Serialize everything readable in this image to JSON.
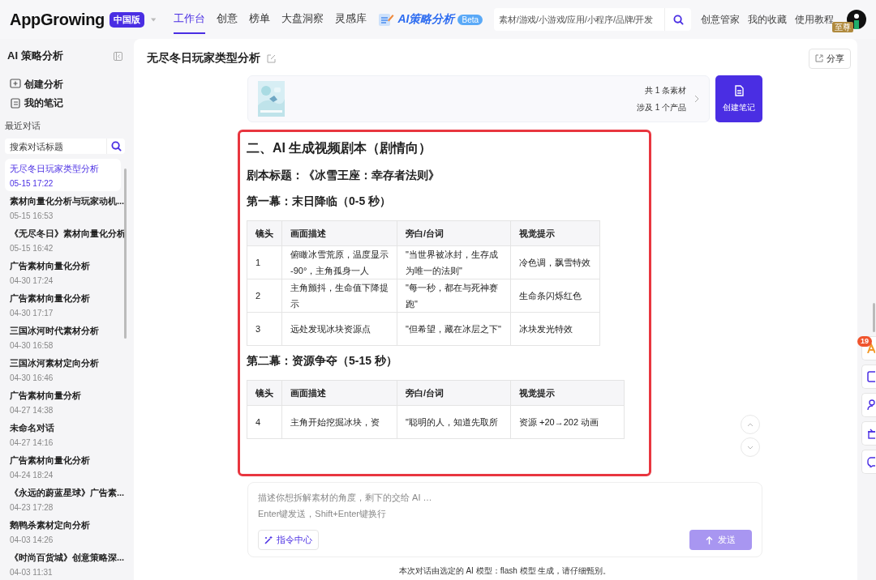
{
  "header": {
    "logo": "AppGrowing",
    "region_badge": "中国版",
    "nav": [
      {
        "label": "工作台",
        "selected": true
      },
      {
        "label": "创意",
        "selected": false
      },
      {
        "label": "榜单",
        "selected": false
      },
      {
        "label": "大盘洞察",
        "selected": false
      },
      {
        "label": "灵感库",
        "selected": false
      }
    ],
    "ai_nav": {
      "label": "AI策略分析",
      "badge": "Beta"
    },
    "search": {
      "placeholder": "素材/游戏/小游戏/应用/小程序/品牌/开发"
    },
    "links": [
      "创意管家",
      "我的收藏",
      "使用教程"
    ],
    "vip_badge": "至尊"
  },
  "sidebar": {
    "title": "AI 策略分析",
    "actions": [
      {
        "kind": "create",
        "label": "创建分析"
      },
      {
        "kind": "notes",
        "label": "我的笔记"
      }
    ],
    "section_label": "最近对话",
    "search": {
      "placeholder": "搜索对话标题"
    },
    "conversations": [
      {
        "title": "无尽冬日玩家类型分析",
        "time": "05-15 17:22",
        "selected": true
      },
      {
        "title": "素材向量化分析与玩家动机...",
        "time": "05-15 16:53",
        "selected": false
      },
      {
        "title": "《无尽冬日》素材向量化分析",
        "time": "05-15 16:42",
        "selected": false
      },
      {
        "title": "广告素材向量化分析",
        "time": "04-30 17:24",
        "selected": false
      },
      {
        "title": "广告素材向量化分析",
        "time": "04-30 17:17",
        "selected": false
      },
      {
        "title": "三国冰河时代素材分析",
        "time": "04-30 16:58",
        "selected": false
      },
      {
        "title": "三国冰河素材定向分析",
        "time": "04-30 16:46",
        "selected": false
      },
      {
        "title": "广告素材向量分析",
        "time": "04-27 14:38",
        "selected": false
      },
      {
        "title": "未命名对话",
        "time": "04-27 14:16",
        "selected": false
      },
      {
        "title": "广告素材向量化分析",
        "time": "04-24 18:24",
        "selected": false
      },
      {
        "title": "《永远的蔚蓝星球》广告素...",
        "time": "04-23 17:28",
        "selected": false
      },
      {
        "title": "鹅鸭杀素材定向分析",
        "time": "04-03 14:26",
        "selected": false
      },
      {
        "title": "《时尚百货城》创意策略深...",
        "time": "04-03 11:31",
        "selected": false
      }
    ]
  },
  "main": {
    "title": "无尽冬日玩家类型分析",
    "share_button": "分享",
    "materials": {
      "kind": "picture",
      "count_text": "共 1 条素材",
      "product_text": "涉及 1 个产品"
    },
    "create_note_button": "创建笔记",
    "content": [
      {
        "kind": "h2",
        "text": "二、AI 生成视频剧本（剧情向）"
      },
      {
        "kind": "h3",
        "text": "剧本标题：《冰雪王座：幸存者法则》"
      },
      {
        "kind": "h3",
        "text": "第一幕：末日降临（0-5 秒）"
      },
      {
        "kind": "table",
        "columns": [
          "镜头",
          "画面描述",
          "旁白/台词",
          "视觉提示"
        ],
        "rows": [
          [
            "1",
            "俯瞰冰雪荒原，温度显示 -90°，主角孤身一人",
            "\"当世界被冰封，生存成为唯一的法则\"",
            "冷色调，飘雪特效"
          ],
          [
            "2",
            "主角颤抖，生命值下降提示",
            "\"每一秒，都在与死神赛跑\"",
            "生命条闪烁红色"
          ],
          [
            "3",
            "远处发现冰块资源点",
            "\"但希望，藏在冰层之下\"",
            "冰块发光特效"
          ]
        ]
      },
      {
        "kind": "h3",
        "text": "第二幕：资源争夺（5-15 秒）"
      },
      {
        "kind": "table",
        "columns": [
          "镜头",
          "画面描述",
          "旁白/台词",
          "视觉提示"
        ],
        "rows": [
          [
            "4",
            "主角开始挖掘冰块，资",
            "\"聪明的人，知道先取所",
            "资源 +20→202 动画"
          ]
        ]
      }
    ],
    "composer": {
      "placeholder": "描述你想拆解素材的角度，剩下的交给 AI …\nEnter键发送，Shift+Enter键换行",
      "command_button": "指令中心",
      "send_button": "发送"
    },
    "footer_note": "本次对话由选定的 AI 模型：flash 模型 生成，请仔细甄别。"
  },
  "rail": {
    "badge": "19"
  }
}
